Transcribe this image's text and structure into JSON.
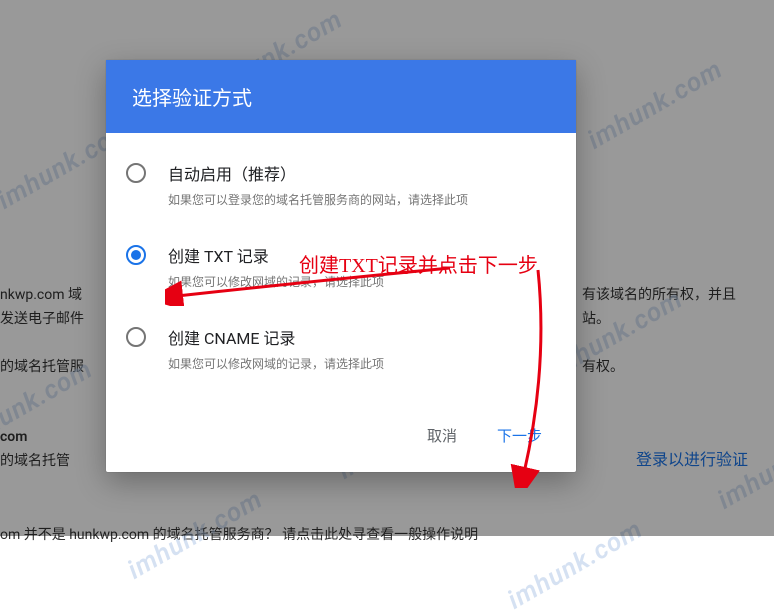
{
  "dialog": {
    "title": "选择验证方式",
    "options": [
      {
        "title": "自动启用（推荐）",
        "desc": "如果您可以登录您的域名托管服务商的网站，请选择此项"
      },
      {
        "title": "创建 TXT 记录",
        "desc": "如果您可以修改网域的记录，请选择此项"
      },
      {
        "title": "创建 CNAME 记录",
        "desc": "如果您可以修改网域的记录，请选择此项"
      }
    ],
    "actions": {
      "cancel": "取消",
      "next": "下一步"
    }
  },
  "annotation": {
    "text": "创建TXT记录并点击下一步"
  },
  "background": {
    "line1a": "nkwp.com 域",
    "line1b": "有该域名的所有权，并且",
    "line2a": "发送电子邮件",
    "line2b": "站。",
    "line3a": "的域名托管服",
    "line3b": "有权。",
    "line4a": "com",
    "line5a": "的域名托管",
    "line5b_link": "登录以进行验证",
    "line6": "om 并不是 hunkwp.com 的域名托管服务商？ 请点击此处寻查看一般操作说明"
  },
  "watermark": "imhunk.com"
}
